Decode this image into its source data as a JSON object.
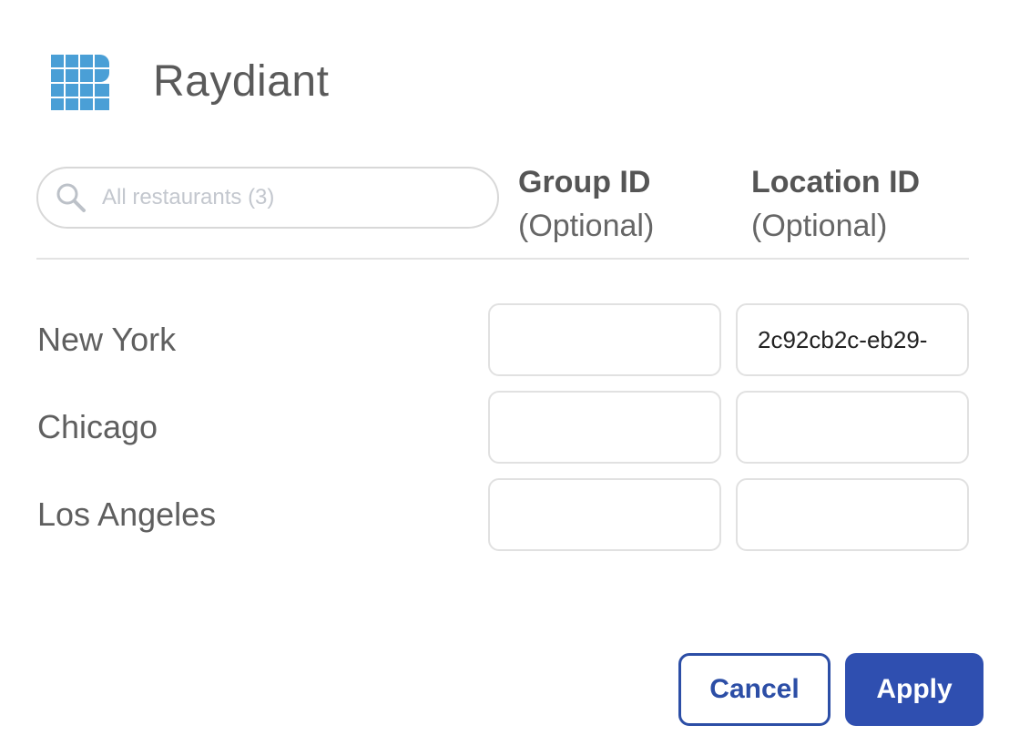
{
  "brand": {
    "name": "Raydiant",
    "logo_icon": "grid-logo-icon",
    "logo_color": "#4a9fd6"
  },
  "search": {
    "icon": "search-icon",
    "placeholder": "All restaurants (3)",
    "value": ""
  },
  "columns": {
    "group": {
      "title": "Group ID",
      "subtitle": "(Optional)"
    },
    "location": {
      "title": "Location ID",
      "subtitle": "(Optional)"
    }
  },
  "rows": [
    {
      "name": "New York",
      "group_id": "",
      "location_id": "2c92cb2c-eb29-"
    },
    {
      "name": "Chicago",
      "group_id": "",
      "location_id": ""
    },
    {
      "name": "Los Angeles",
      "group_id": "",
      "location_id": ""
    }
  ],
  "actions": {
    "cancel_label": "Cancel",
    "apply_label": "Apply",
    "primary_color": "#2f4fb0"
  }
}
